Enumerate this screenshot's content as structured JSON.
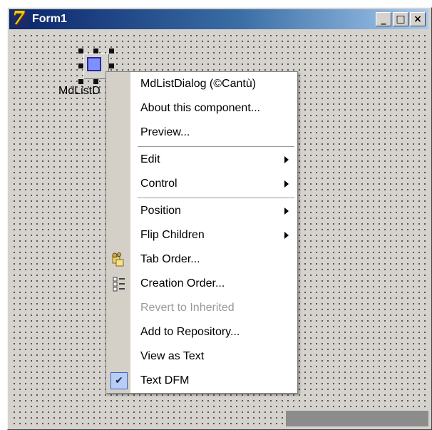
{
  "window": {
    "title": "Form1",
    "app_icon_text": "7",
    "minimize_label": "_",
    "maximize_label": "□",
    "close_label": "×"
  },
  "component": {
    "label": "MdListD"
  },
  "menu": {
    "items": [
      {
        "label": "MdListDialog (©Cantù)"
      },
      {
        "label": "About this component..."
      },
      {
        "label": "Preview..."
      },
      {
        "label": "Edit"
      },
      {
        "label": "Control"
      },
      {
        "label": "Position"
      },
      {
        "label": "Flip Children"
      },
      {
        "label": "Tab Order..."
      },
      {
        "label": "Creation Order..."
      },
      {
        "label": "Revert to Inherited"
      },
      {
        "label": "Add to Repository..."
      },
      {
        "label": "View as Text"
      },
      {
        "label": "Text DFM"
      }
    ],
    "check_glyph": "✔"
  },
  "colors": {
    "titlebar_start": "#0a246a",
    "titlebar_end": "#a6caf0",
    "face": "#d6d3ce",
    "disabled_text": "#9a9a9a",
    "check_highlight": "#b9cdf2"
  }
}
